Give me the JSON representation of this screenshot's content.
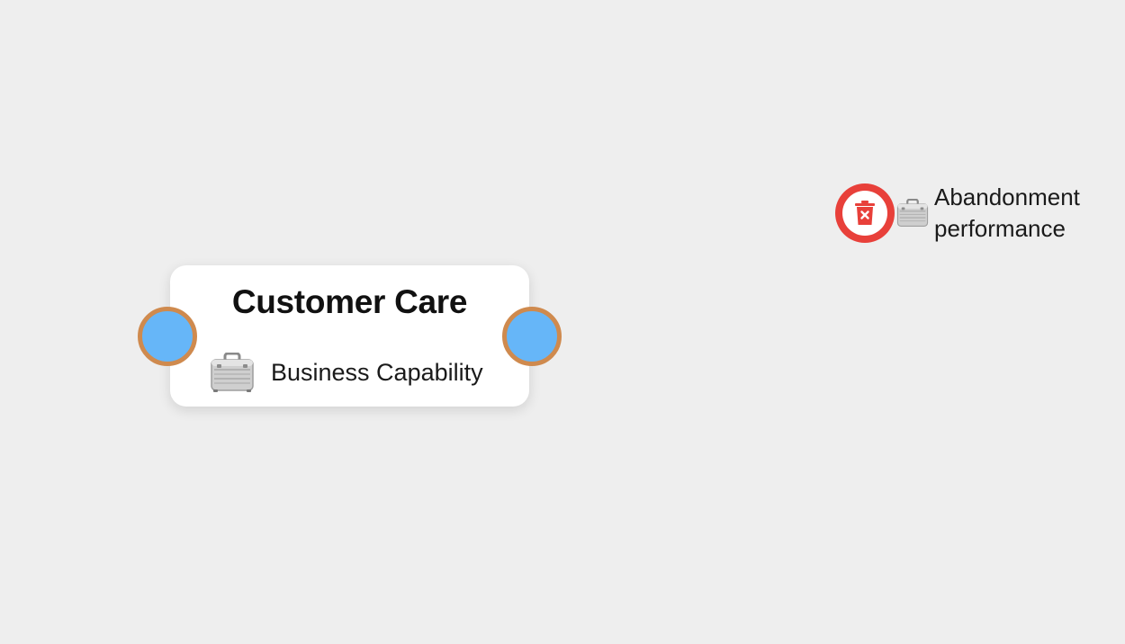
{
  "canvas": {
    "background": "#eeeeee"
  },
  "node": {
    "title": "Customer Care",
    "type_label": "Business Capability",
    "type_icon": "briefcase-icon",
    "port_fill": "#66b6f8",
    "port_border": "#cf8a4e"
  },
  "floating_element": {
    "label_line1": "Abandonment",
    "label_line2": "performance",
    "type_icon": "briefcase-icon",
    "delete_icon": "trash-icon",
    "delete_color": "#e8403a"
  }
}
